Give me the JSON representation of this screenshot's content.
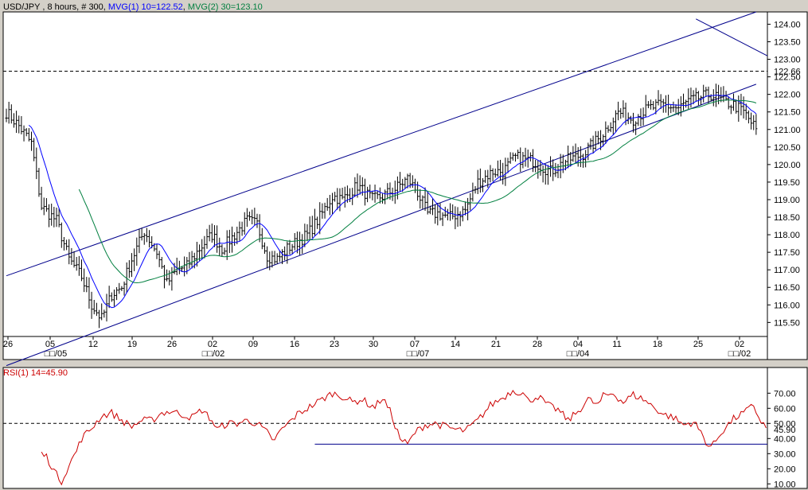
{
  "chart_data": [
    {
      "type": "ohlc",
      "header": {
        "symbol": "USD/JPY",
        "interval": "8 hours",
        "count": "# 300",
        "ma1_label": "MVG(1) 10=122.52",
        "ma2_label": "MVG(2) 30=123.10"
      },
      "ylim": [
        115.1,
        124.35
      ],
      "y_ticks": [
        "124.00",
        "123.50",
        "123.00",
        "122.50",
        "122.00",
        "121.50",
        "121.00",
        "120.50",
        "120.00",
        "119.50",
        "119.00",
        "118.50",
        "118.00",
        "117.50",
        "117.00",
        "116.50",
        "116.00",
        "115.50"
      ],
      "last_value_label": "122.66",
      "last_value": 122.66,
      "x_day_labels": [
        "26",
        "05",
        "12",
        "19",
        "26",
        "02",
        "09",
        "16",
        "23",
        "30",
        "07",
        "14",
        "21",
        "28",
        "04",
        "11",
        "18",
        "25",
        "02"
      ],
      "x_month_labels": [
        "□□/05",
        "□□/02",
        "□□/07",
        "□□/04",
        "□□/02"
      ],
      "n_bars": 300,
      "close_anchors": [
        [
          0,
          121.5
        ],
        [
          5,
          121.1
        ],
        [
          10,
          120.6
        ],
        [
          14,
          118.8
        ],
        [
          20,
          118.4
        ],
        [
          25,
          117.3
        ],
        [
          30,
          116.8
        ],
        [
          34,
          116.0
        ],
        [
          38,
          115.6
        ],
        [
          42,
          116.3
        ],
        [
          46,
          116.5
        ],
        [
          50,
          117.3
        ],
        [
          55,
          118.1
        ],
        [
          60,
          117.5
        ],
        [
          64,
          116.6
        ],
        [
          68,
          117.0
        ],
        [
          72,
          117.1
        ],
        [
          77,
          117.6
        ],
        [
          82,
          118.0
        ],
        [
          86,
          117.6
        ],
        [
          91,
          118.0
        ],
        [
          96,
          118.4
        ],
        [
          100,
          118.3
        ],
        [
          104,
          117.4
        ],
        [
          108,
          117.3
        ],
        [
          112,
          117.6
        ],
        [
          116,
          117.8
        ],
        [
          120,
          118.0
        ],
        [
          125,
          118.5
        ],
        [
          130,
          119.1
        ],
        [
          134,
          119.0
        ],
        [
          140,
          119.4
        ],
        [
          146,
          119.0
        ],
        [
          150,
          119.1
        ],
        [
          155,
          119.3
        ],
        [
          160,
          119.6
        ],
        [
          164,
          119.2
        ],
        [
          168,
          118.6
        ],
        [
          172,
          118.6
        ],
        [
          177,
          118.5
        ],
        [
          183,
          118.7
        ],
        [
          188,
          119.5
        ],
        [
          194,
          119.8
        ],
        [
          198,
          119.8
        ],
        [
          203,
          120.2
        ],
        [
          210,
          120.1
        ],
        [
          217,
          119.8
        ],
        [
          223,
          120.1
        ],
        [
          230,
          120.3
        ],
        [
          237,
          120.8
        ],
        [
          244,
          121.5
        ],
        [
          250,
          121.3
        ],
        [
          256,
          121.6
        ],
        [
          262,
          121.7
        ],
        [
          268,
          121.6
        ],
        [
          272,
          121.8
        ],
        [
          276,
          121.9
        ],
        [
          281,
          122.0
        ],
        [
          286,
          121.8
        ],
        [
          290,
          121.7
        ],
        [
          294,
          121.5
        ],
        [
          297,
          121.2
        ],
        [
          299,
          121.0
        ]
      ],
      "ma_periods": [
        10,
        30
      ],
      "channel_upper": [
        [
          0,
          116.83
        ],
        [
          299,
          124.35
        ]
      ],
      "channel_lower": [
        [
          0,
          114.27
        ],
        [
          299,
          122.29
        ]
      ],
      "colors": {
        "bars": "#000000",
        "ma1": "#0000ff",
        "ma2": "#007f3f",
        "channel": "#00008b",
        "ref_line": "#000000"
      }
    },
    {
      "type": "line",
      "header": {
        "rsi_label": "RSI(1) 14=45.90"
      },
      "ylim": [
        7,
        87
      ],
      "y_ticks": [
        "70.00",
        "60.00",
        "50.00",
        "40.00",
        "30.00",
        "20.00",
        "10.00"
      ],
      "ref_level": 50,
      "last_value_label": "45.90",
      "last_value": 45.9,
      "support_level": 36.3,
      "rsi_anchors": [
        [
          14,
          30
        ],
        [
          16,
          28
        ],
        [
          20,
          16
        ],
        [
          22,
          12
        ],
        [
          24,
          19
        ],
        [
          28,
          32
        ],
        [
          30,
          40
        ],
        [
          34,
          47
        ],
        [
          38,
          55
        ],
        [
          42,
          57
        ],
        [
          46,
          52
        ],
        [
          50,
          48
        ],
        [
          54,
          52
        ],
        [
          58,
          52
        ],
        [
          62,
          57
        ],
        [
          66,
          58
        ],
        [
          70,
          56
        ],
        [
          74,
          54
        ],
        [
          78,
          59
        ],
        [
          82,
          52
        ],
        [
          84,
          46
        ],
        [
          88,
          50
        ],
        [
          92,
          50
        ],
        [
          96,
          52
        ],
        [
          100,
          50
        ],
        [
          104,
          44
        ],
        [
          106,
          38
        ],
        [
          110,
          46
        ],
        [
          116,
          56
        ],
        [
          122,
          62
        ],
        [
          126,
          66
        ],
        [
          130,
          70
        ],
        [
          134,
          68
        ],
        [
          138,
          64
        ],
        [
          142,
          66
        ],
        [
          145,
          62
        ],
        [
          147,
          61
        ],
        [
          150,
          67
        ],
        [
          153,
          58
        ],
        [
          157,
          40
        ],
        [
          160,
          36
        ],
        [
          163,
          44
        ],
        [
          167,
          49
        ],
        [
          171,
          50
        ],
        [
          175,
          48
        ],
        [
          179,
          46
        ],
        [
          183,
          45
        ],
        [
          188,
          52
        ],
        [
          193,
          62
        ],
        [
          198,
          67
        ],
        [
          202,
          72
        ],
        [
          206,
          70
        ],
        [
          208,
          65
        ],
        [
          212,
          68
        ],
        [
          216,
          62
        ],
        [
          220,
          59
        ],
        [
          224,
          52
        ],
        [
          228,
          58
        ],
        [
          232,
          66
        ],
        [
          236,
          62
        ],
        [
          238,
          68
        ],
        [
          242,
          70
        ],
        [
          246,
          64
        ],
        [
          250,
          69
        ],
        [
          254,
          66
        ],
        [
          258,
          61
        ],
        [
          262,
          56
        ],
        [
          266,
          54
        ],
        [
          270,
          49
        ],
        [
          274,
          51
        ],
        [
          277,
          44
        ],
        [
          279,
          38
        ],
        [
          280,
          35
        ],
        [
          282,
          36
        ],
        [
          285,
          44
        ],
        [
          290,
          53
        ],
        [
          295,
          58
        ],
        [
          298,
          62
        ],
        [
          300,
          54
        ],
        [
          303,
          47
        ]
      ],
      "rsi_anchors_scale": "bars",
      "colors": {
        "rsi": "#cc0000",
        "ref_line": "#000000",
        "support": "#00008b"
      }
    }
  ]
}
